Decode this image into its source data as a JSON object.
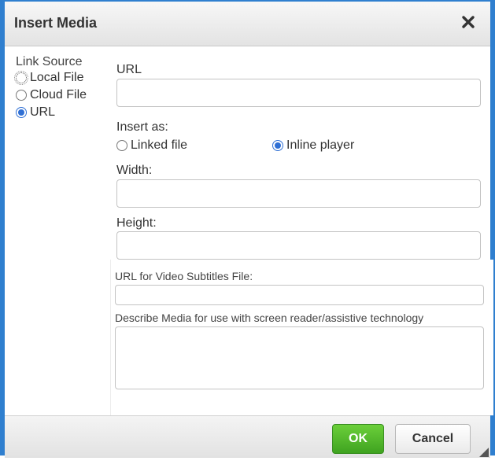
{
  "dialog": {
    "title": "Insert Media",
    "close_icon": "close-icon",
    "accent_color": "#2f7fcf"
  },
  "link_source": {
    "legend": "Link Source",
    "options": [
      {
        "label": "Local File",
        "checked": false
      },
      {
        "label": "Cloud File",
        "checked": false
      },
      {
        "label": "URL",
        "checked": true
      }
    ]
  },
  "form": {
    "url_label": "URL",
    "url_value": "",
    "insert_as_label": "Insert as:",
    "insert_as_options": [
      {
        "label": "Linked file",
        "checked": false
      },
      {
        "label": "Inline player",
        "checked": true
      }
    ],
    "width_label": "Width:",
    "width_value": "",
    "height_label": "Height:",
    "height_value": "",
    "subtitles_label": "URL for Video Subtitles File:",
    "subtitles_value": "",
    "describe_label": "Describe Media for use with screen reader/assistive technology",
    "describe_value": ""
  },
  "footer": {
    "ok_label": "OK",
    "cancel_label": "Cancel",
    "ok_color": "#4cb82a"
  }
}
